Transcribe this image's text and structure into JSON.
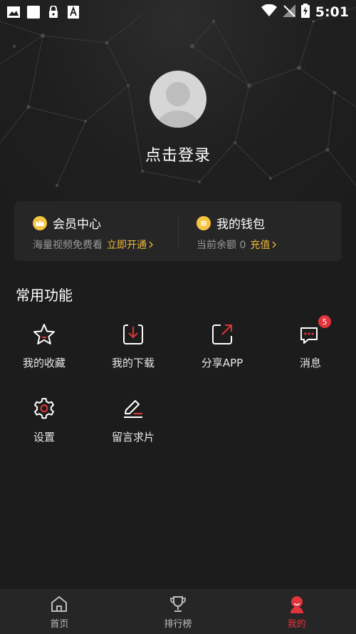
{
  "status_bar": {
    "time": "5:01",
    "left_icons": [
      "image-icon",
      "square-icon",
      "lock-icon",
      "font-icon"
    ],
    "right_icons": [
      "wifi-icon",
      "no-signal-icon",
      "battery-charging-icon"
    ]
  },
  "profile": {
    "login_text": "点击登录"
  },
  "cards": {
    "vip": {
      "title": "会员中心",
      "subtitle": "海量视频免费看",
      "link": "立即开通"
    },
    "wallet": {
      "title": "我的钱包",
      "subtitle": "当前余额 0",
      "link": "充值"
    }
  },
  "features": {
    "title": "常用功能",
    "items": [
      {
        "label": "我的收藏",
        "icon": "star-icon"
      },
      {
        "label": "我的下载",
        "icon": "download-icon"
      },
      {
        "label": "分享APP",
        "icon": "share-icon"
      },
      {
        "label": "消息",
        "icon": "message-icon",
        "badge": "5"
      },
      {
        "label": "设置",
        "icon": "gear-icon"
      },
      {
        "label": "留言求片",
        "icon": "edit-icon"
      }
    ]
  },
  "tabbar": {
    "tabs": [
      {
        "label": "首页",
        "icon": "home-icon"
      },
      {
        "label": "排行榜",
        "icon": "trophy-icon"
      },
      {
        "label": "我的",
        "icon": "profile-icon",
        "active": true
      }
    ]
  },
  "colors": {
    "accent": "#e3343c",
    "gold": "#f0b83a",
    "background": "#1c1c1c",
    "card": "#262626"
  }
}
